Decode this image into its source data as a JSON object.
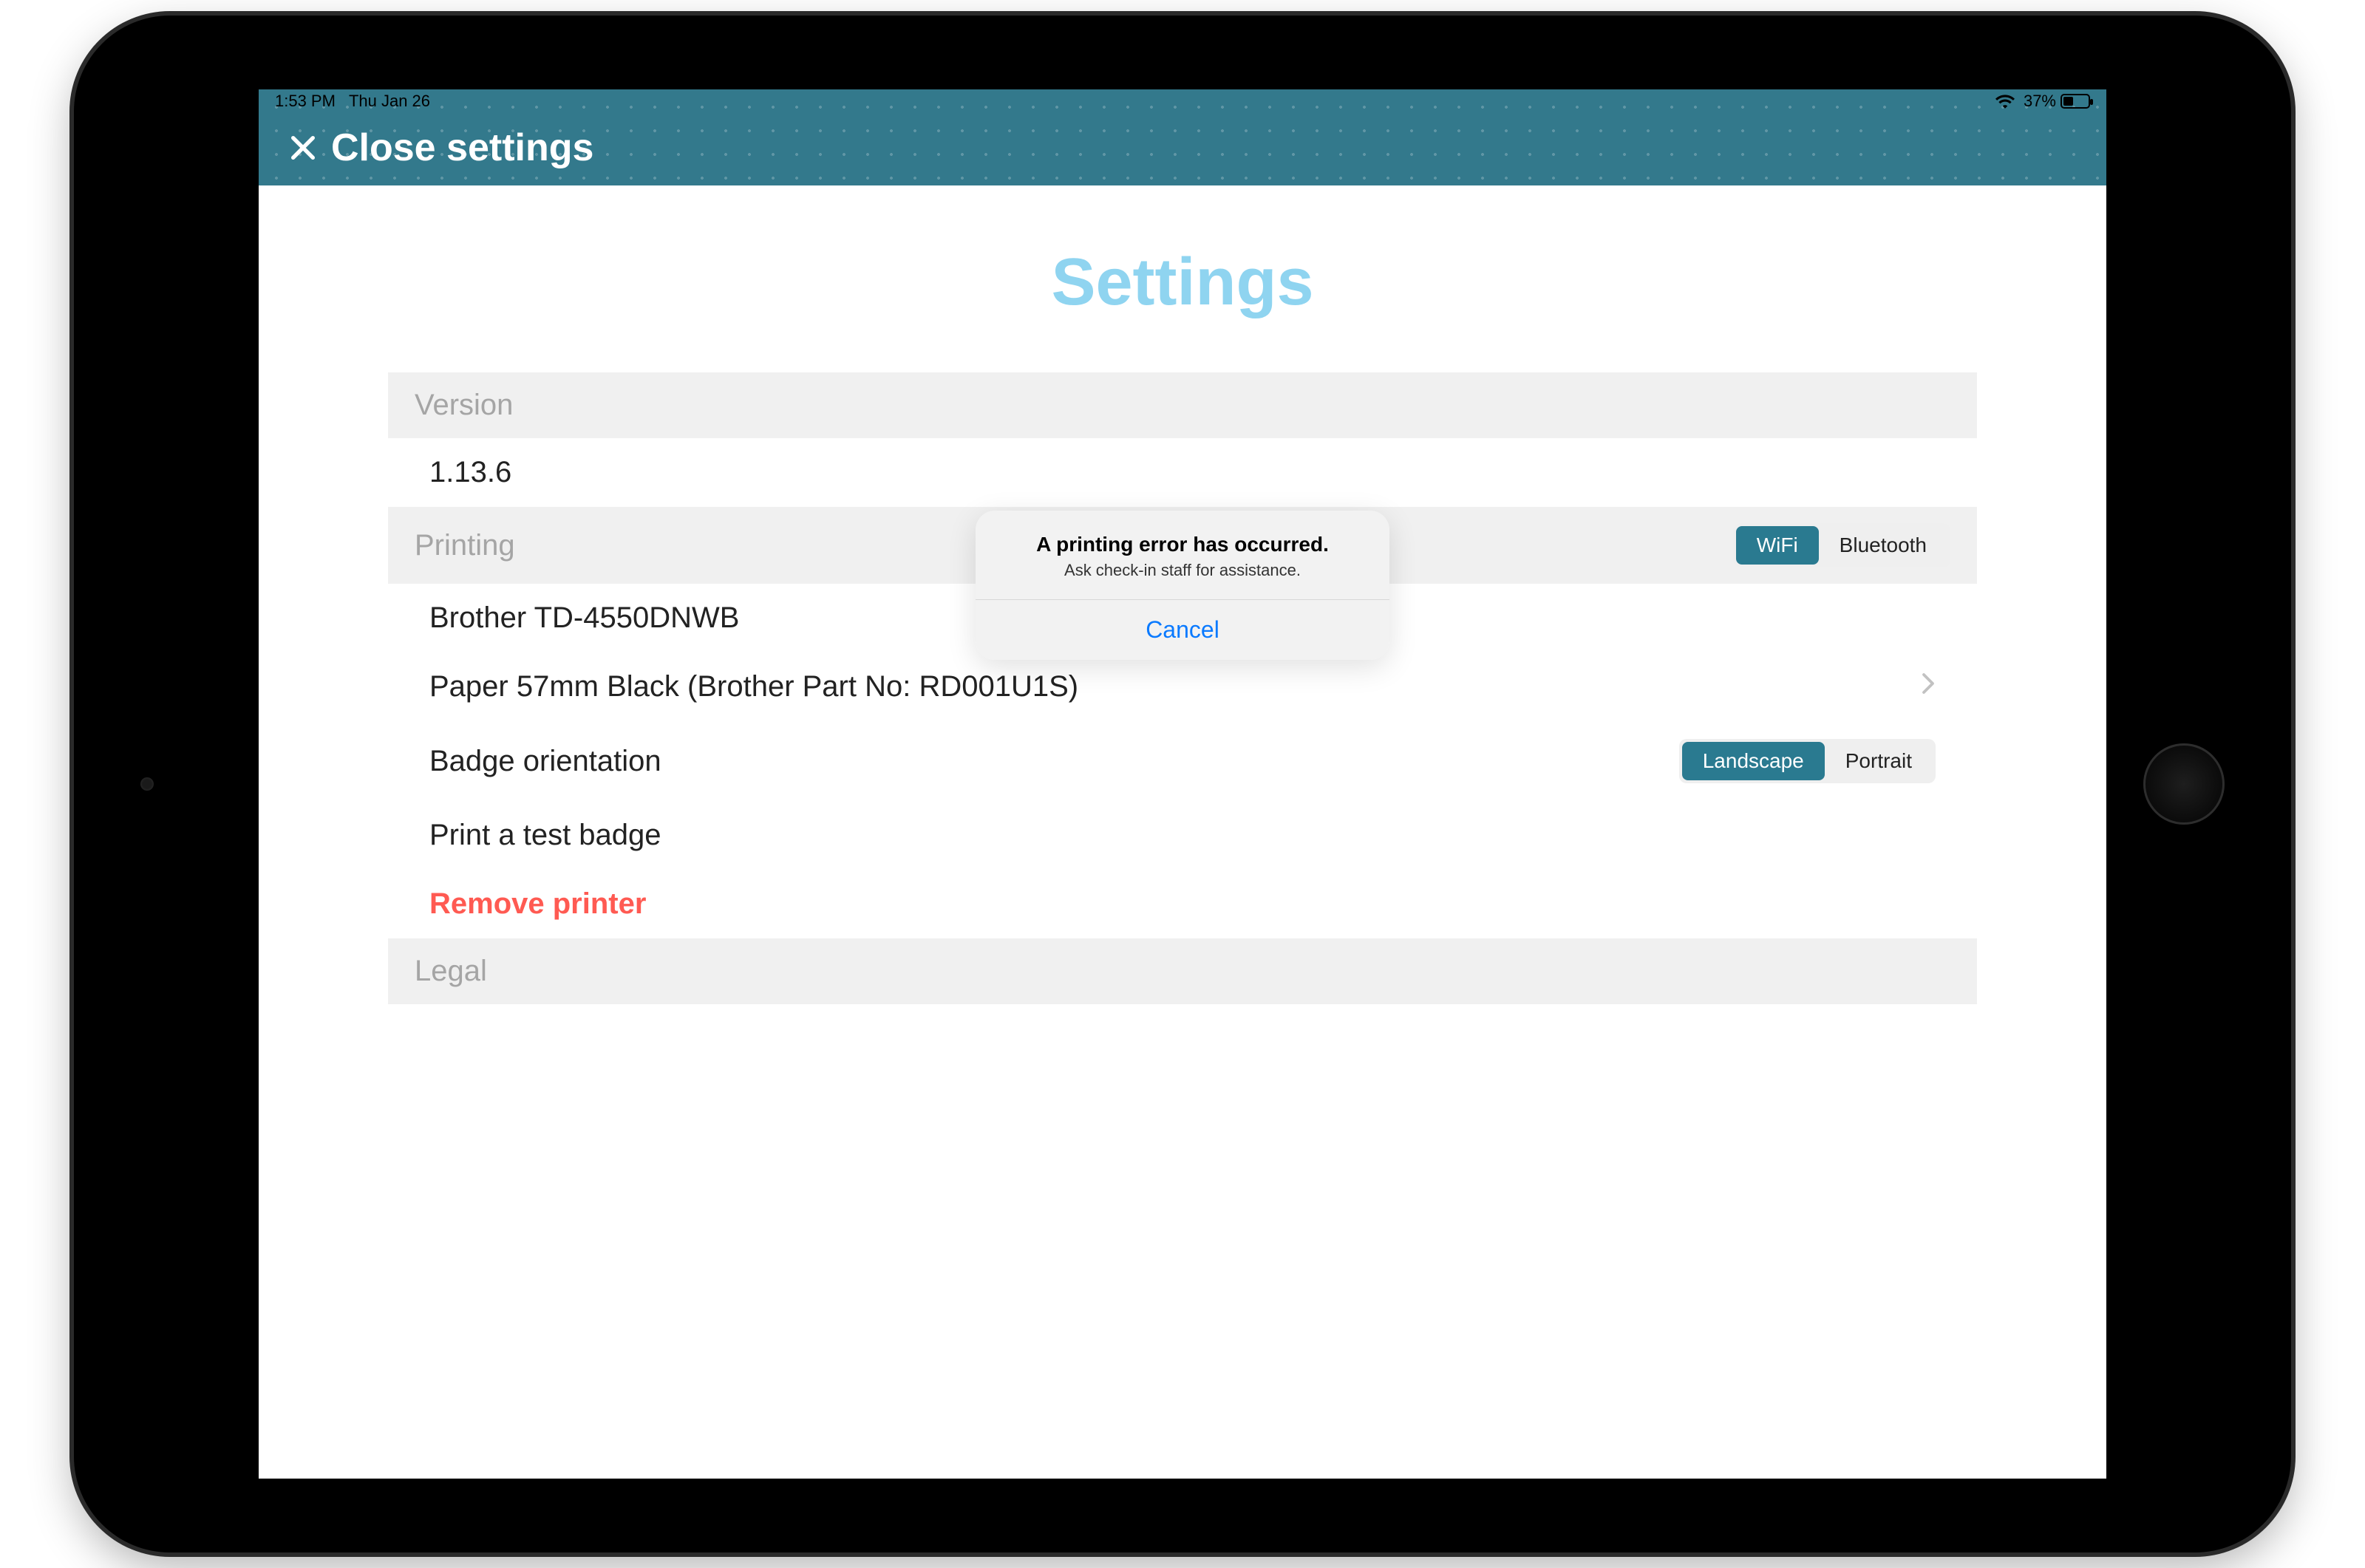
{
  "status": {
    "time": "1:53 PM",
    "date": "Thu Jan 26",
    "battery_pct": "37%"
  },
  "header": {
    "close_label": "Close settings"
  },
  "page": {
    "title": "Settings"
  },
  "sections": {
    "version": {
      "header": "Version",
      "value": "1.13.6"
    },
    "printing": {
      "header": "Printing",
      "connection": {
        "wifi": "WiFi",
        "bluetooth": "Bluetooth",
        "selected": "WiFi"
      },
      "printer_name": "Brother TD-4550DNWB",
      "paper": "Paper 57mm Black (Brother Part No: RD001U1S)",
      "orientation_label": "Badge orientation",
      "orientation": {
        "landscape": "Landscape",
        "portrait": "Portrait",
        "selected": "Landscape"
      },
      "test_badge": "Print a test badge",
      "remove": "Remove printer"
    },
    "legal": {
      "header": "Legal"
    }
  },
  "alert": {
    "title": "A printing error has occurred.",
    "message": "Ask check-in staff for assistance.",
    "cancel": "Cancel"
  }
}
